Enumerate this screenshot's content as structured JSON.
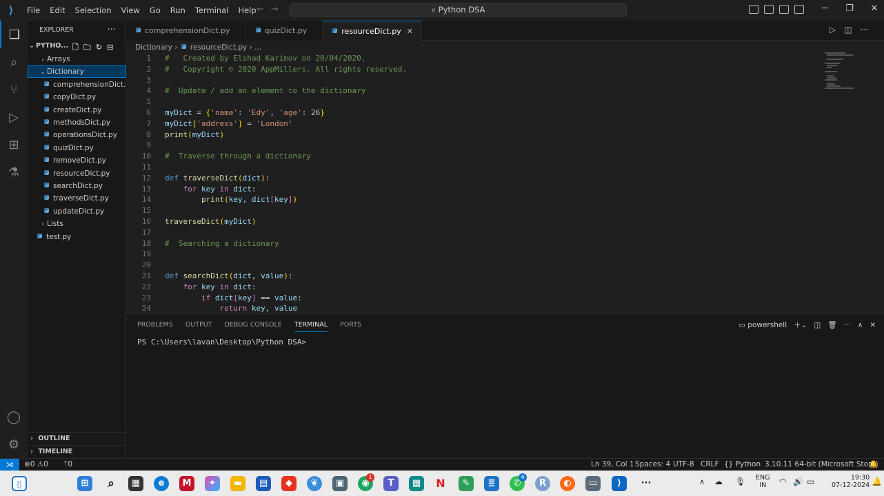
{
  "menus": [
    "File",
    "Edit",
    "Selection",
    "View",
    "Go",
    "Run",
    "Terminal",
    "Help"
  ],
  "search": "Python DSA",
  "explorer": {
    "title": "EXPLORER",
    "root": "PYTHO...",
    "items": [
      {
        "label": "Arrays",
        "type": "folder",
        "open": false
      },
      {
        "label": "Dictionary",
        "type": "folder",
        "open": true
      },
      {
        "label": "comprehensionDict....",
        "type": "file"
      },
      {
        "label": "copyDict.py",
        "type": "file"
      },
      {
        "label": "createDict.py",
        "type": "file"
      },
      {
        "label": "methodsDict.py",
        "type": "file"
      },
      {
        "label": "operationsDict.py",
        "type": "file"
      },
      {
        "label": "quizDict.py",
        "type": "file"
      },
      {
        "label": "removeDict.py",
        "type": "file"
      },
      {
        "label": "resourceDict.py",
        "type": "file"
      },
      {
        "label": "searchDict.py",
        "type": "file"
      },
      {
        "label": "traverseDict.py",
        "type": "file"
      },
      {
        "label": "updateDict.py",
        "type": "file"
      },
      {
        "label": "Lists",
        "type": "folder",
        "open": false
      },
      {
        "label": "test.py",
        "type": "file"
      }
    ],
    "outline": "OUTLINE",
    "timeline": "TIMELINE"
  },
  "tabs": [
    {
      "label": "comprehensionDict.py",
      "active": false
    },
    {
      "label": "quizDict.py",
      "active": false
    },
    {
      "label": "resourceDict.py",
      "active": true
    }
  ],
  "breadcrumb": {
    "folder": "Dictionary",
    "file": "resourceDict.py",
    "rest": "..."
  },
  "code": [
    {
      "n": "1",
      "t": [
        [
          "c-comment",
          "#   Created by Elshad Karimov on 20/04/2020."
        ]
      ]
    },
    {
      "n": "2",
      "t": [
        [
          "c-comment",
          "#   Copyright © 2020 AppMillers. All rights reserved."
        ]
      ]
    },
    {
      "n": "3",
      "t": []
    },
    {
      "n": "4",
      "t": [
        [
          "c-comment",
          "#  Update / add an element to the dictionary"
        ]
      ]
    },
    {
      "n": "5",
      "t": []
    },
    {
      "n": "6",
      "t": [
        [
          "c-var",
          "myDict"
        ],
        [
          "c-op",
          " = "
        ],
        [
          "c-br",
          "{"
        ],
        [
          "c-str",
          "'name'"
        ],
        [
          "c-op",
          ": "
        ],
        [
          "c-str",
          "'Edy'"
        ],
        [
          "c-op",
          ", "
        ],
        [
          "c-str",
          "'age'"
        ],
        [
          "c-op",
          ": "
        ],
        [
          "c-num",
          "26"
        ],
        [
          "c-br",
          "}"
        ]
      ]
    },
    {
      "n": "7",
      "t": [
        [
          "c-var",
          "myDict"
        ],
        [
          "c-br",
          "["
        ],
        [
          "c-str",
          "'address'"
        ],
        [
          "c-br",
          "]"
        ],
        [
          "c-op",
          " = "
        ],
        [
          "c-str",
          "'London'"
        ]
      ]
    },
    {
      "n": "8",
      "t": [
        [
          "c-fn",
          "print"
        ],
        [
          "c-br",
          "("
        ],
        [
          "c-var",
          "myDict"
        ],
        [
          "c-br",
          ")"
        ]
      ]
    },
    {
      "n": "9",
      "t": []
    },
    {
      "n": "10",
      "t": [
        [
          "c-comment",
          "#  Traverse through a dictionary"
        ]
      ]
    },
    {
      "n": "11",
      "t": []
    },
    {
      "n": "12",
      "t": [
        [
          "c-kw",
          "def "
        ],
        [
          "c-fn",
          "traverseDict"
        ],
        [
          "c-br",
          "("
        ],
        [
          "c-var",
          "dict"
        ],
        [
          "c-br",
          ")"
        ],
        [
          "c-op",
          ":"
        ]
      ]
    },
    {
      "n": "13",
      "t": [
        [
          "c-op",
          "    "
        ],
        [
          "c-ctl",
          "for "
        ],
        [
          "c-var",
          "key"
        ],
        [
          "c-ctl",
          " in "
        ],
        [
          "c-var",
          "dict"
        ],
        [
          "c-op",
          ":"
        ]
      ]
    },
    {
      "n": "14",
      "t": [
        [
          "c-op",
          "        "
        ],
        [
          "c-fn",
          "print"
        ],
        [
          "c-br",
          "("
        ],
        [
          "c-var",
          "key"
        ],
        [
          "c-op",
          ", "
        ],
        [
          "c-var",
          "dict"
        ],
        [
          "c-br2",
          "["
        ],
        [
          "c-var",
          "key"
        ],
        [
          "c-br2",
          "]"
        ],
        [
          "c-br",
          ")"
        ]
      ]
    },
    {
      "n": "15",
      "t": []
    },
    {
      "n": "16",
      "t": [
        [
          "c-fn",
          "traverseDict"
        ],
        [
          "c-br",
          "("
        ],
        [
          "c-var",
          "myDict"
        ],
        [
          "c-br",
          ")"
        ]
      ]
    },
    {
      "n": "17",
      "t": []
    },
    {
      "n": "18",
      "t": [
        [
          "c-comment",
          "#  Searching a dictionary"
        ]
      ]
    },
    {
      "n": "19",
      "t": []
    },
    {
      "n": "20",
      "t": []
    },
    {
      "n": "21",
      "t": [
        [
          "c-kw",
          "def "
        ],
        [
          "c-fn",
          "searchDict"
        ],
        [
          "c-br",
          "("
        ],
        [
          "c-var",
          "dict"
        ],
        [
          "c-op",
          ", "
        ],
        [
          "c-var",
          "value"
        ],
        [
          "c-br",
          ")"
        ],
        [
          "c-op",
          ":"
        ]
      ]
    },
    {
      "n": "22",
      "t": [
        [
          "c-op",
          "    "
        ],
        [
          "c-ctl",
          "for "
        ],
        [
          "c-var",
          "key"
        ],
        [
          "c-ctl",
          " in "
        ],
        [
          "c-var",
          "dict"
        ],
        [
          "c-op",
          ":"
        ]
      ]
    },
    {
      "n": "23",
      "t": [
        [
          "c-op",
          "        "
        ],
        [
          "c-ctl",
          "if "
        ],
        [
          "c-var",
          "dict"
        ],
        [
          "c-br2",
          "["
        ],
        [
          "c-var",
          "key"
        ],
        [
          "c-br2",
          "]"
        ],
        [
          "c-op",
          " == "
        ],
        [
          "c-var",
          "value"
        ],
        [
          "c-op",
          ":"
        ]
      ]
    },
    {
      "n": "24",
      "t": [
        [
          "c-op",
          "            "
        ],
        [
          "c-ctl",
          "return "
        ],
        [
          "c-var",
          "key"
        ],
        [
          "c-op",
          ", "
        ],
        [
          "c-var",
          "value"
        ]
      ]
    }
  ],
  "panel": {
    "tabs": [
      "PROBLEMS",
      "OUTPUT",
      "DEBUG CONSOLE",
      "TERMINAL",
      "PORTS"
    ],
    "active_tab": "TERMINAL",
    "shell": "powershell",
    "prompt": "PS C:\\Users\\lavan\\Desktop\\Python DSA>"
  },
  "status": {
    "errors": "0",
    "warnings": "0",
    "ports": "0",
    "position": "Ln 39, Col 1",
    "spaces": "Spaces: 4",
    "encoding": "UTF-8",
    "eol": "CRLF",
    "language": "Python",
    "interpreter": "3.10.11 64-bit (Microsoft Store)"
  },
  "taskbar": {
    "lang1": "ENG",
    "lang2": "IN",
    "time": "19:30",
    "date": "07-12-2024",
    "badges": [
      "1",
      "4"
    ]
  },
  "colors": {
    "accent": "#0078d4",
    "bg": "#1f1f1f",
    "sidebar": "#181818"
  }
}
